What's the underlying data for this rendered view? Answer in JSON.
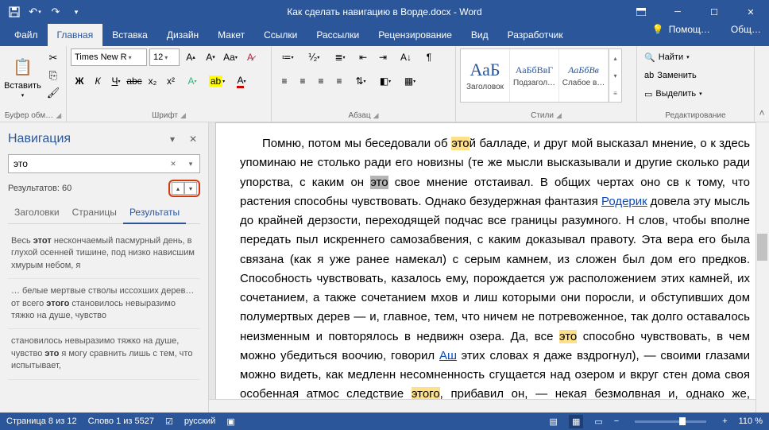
{
  "title": "Как сделать навигацию в Ворде.docx - Word",
  "menu": {
    "file": "Файл",
    "home": "Главная",
    "insert": "Вставка",
    "design": "Дизайн",
    "layout": "Макет",
    "references": "Ссылки",
    "mailings": "Рассылки",
    "review": "Рецензирование",
    "view": "Вид",
    "developer": "Разработчик",
    "tell": "Помощ…",
    "share": "Общ…"
  },
  "ribbon": {
    "clipboard": {
      "label": "Буфер обм…",
      "paste": "Вставить"
    },
    "font": {
      "label": "Шрифт",
      "name": "Times New R",
      "size": "12"
    },
    "paragraph": {
      "label": "Абзац"
    },
    "styles": {
      "label": "Стили",
      "items": [
        {
          "preview": "АаБ",
          "name": "Заголовок",
          "big": true
        },
        {
          "preview": "АаБбВвГ",
          "name": "Подзагол…"
        },
        {
          "preview": "АаБбВв",
          "name": "Слабое в…",
          "italic": true
        }
      ]
    },
    "editing": {
      "label": "Редактирование",
      "find": "Найти",
      "replace": "Заменить",
      "select": "Выделить"
    }
  },
  "nav": {
    "title": "Навигация",
    "search": "это",
    "results_label": "Результатов: 60",
    "tabs": {
      "headings": "Заголовки",
      "pages": "Страницы",
      "results": "Результаты"
    },
    "items": [
      {
        "pre": "Весь ",
        "b": "этот",
        "post": " нескончаемый пасмурный день, в глухой осенней тишине, под низко нависшим хмурым небом, я"
      },
      {
        "pre": "… белые мертвые стволы иссохших дерев… от всего ",
        "b": "этого",
        "post": " становилось невыразимо тяжко на душе, чувство"
      },
      {
        "pre": "становилось невыразимо тяжко на душе, чувство ",
        "b": "это",
        "post": " я могу сравнить лишь с тем, что испытывает,"
      }
    ]
  },
  "doc": {
    "t1a": "Помню, потом мы беседовали об ",
    "h1": "это",
    "t1b": "й балладе, и друг мой высказал мнение, о к",
    "t2": "здесь упоминаю не столько ради его новизны (те же мысли высказывали и другие",
    "t3a": "сколько ради упорства, с каким он ",
    "h3": "это",
    "t3b": " свое мнение отстаивал. В общих чертах оно св",
    "t4a": "к тому, что растения способны чувствовать. Однако безудержная фантазия ",
    "l4": "Родерик",
    "t5": "довела эту мысль до крайней дерзости, переходящей подчас все границы разумного. Н",
    "t6": "слов, чтобы вполне передать пыл искреннего самозабвения, с каким доказывал ",
    "t7": "правоту. Эта вера его была связана (как я уже ранее намекал) с серым камнем, из ",
    "t8": "сложен был дом его предков. Способность чувствовать, казалось ему, порождается уж",
    "t9": "расположением этих камней, их сочетанием, а также сочетанием мхов и лиш",
    "t10": "которыми они поросли, и обступивших дом полумертвых дерев — и, главное, тем, что",
    "t11": "ничем не потревоженное, так долго оставалось неизменным и повторялось в недвижн",
    "t12a": "озера. Да, все ",
    "h12": "это",
    "t12b": " способно чувствовать, в чем можно убедиться воочию, говорил ",
    "l12": "Аш",
    "t13": "этих словах я даже вздрогнул), — своими глазами можно видеть, как медленн",
    "t14": "несомненность сгущается над озером и вкруг стен дома своя особенная атмос",
    "t15a": "следствие ",
    "h15": "этого",
    "t15b": ", прибавил он, — некая безмолвная и, однако же, неодолимая и грозн"
  },
  "status": {
    "page": "Страница 8 из 12",
    "words": "Слово 1 из 5527",
    "lang": "русский",
    "zoom": "110 %"
  }
}
